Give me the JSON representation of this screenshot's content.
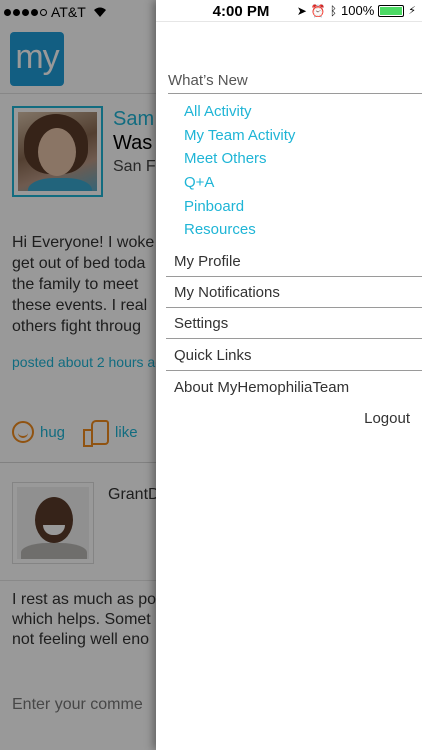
{
  "background": {
    "status": {
      "carrier": "AT&T"
    },
    "logo_text": "my",
    "post1": {
      "author_fragment": "Sam",
      "line2_fragment": "Was",
      "line3_fragment": "San F",
      "body": "Hi Everyone! I woke\nget out of bed toda\nthe family to meet\nthese events. I real\nothers fight throug",
      "timestamp": "posted about 2 hours ag",
      "hug_label": "hug",
      "like_label": "like"
    },
    "post2": {
      "author_fragment": "GrantD",
      "body": "I rest as much as po\nwhich helps. Somet\nnot feeling well eno"
    },
    "comment_placeholder": "Enter your comme"
  },
  "menu": {
    "status": {
      "time": "4:00 PM",
      "battery": "100%"
    },
    "section_title": "What’s New",
    "subitems": [
      "All Activity",
      "My Team Activity",
      "Meet Others",
      "Q+A",
      "Pinboard",
      "Resources"
    ],
    "items": [
      "My Profile",
      "My Notifications",
      "Settings",
      "Quick Links",
      "About MyHemophiliaTeam"
    ],
    "logout": "Logout"
  },
  "colors": {
    "accent": "#1fb5d6",
    "logo": "#1f9dd9",
    "reaction": "#f08a1d"
  }
}
